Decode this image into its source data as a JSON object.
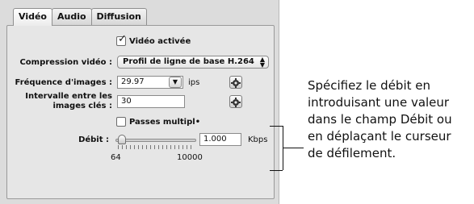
{
  "tabs": [
    {
      "label": "Vidéo",
      "active": true
    },
    {
      "label": "Audio",
      "active": false
    },
    {
      "label": "Diffusion",
      "active": false
    }
  ],
  "video_enabled": {
    "label": "Vidéo activée",
    "checked": true
  },
  "compression": {
    "label": "Compression vidéo :",
    "value": "Profil de ligne de base H.264"
  },
  "frame_rate": {
    "label": "Fréquence d'images :",
    "value": "29.97",
    "unit": "ips"
  },
  "keyframe": {
    "label_line1": "Intervalle entre les",
    "label_line2": "images clés :",
    "value": "30"
  },
  "multipass": {
    "label": "Passes multipl•",
    "checked": false
  },
  "bitrate": {
    "label": "Débit :",
    "value": "1.000",
    "unit": "Kbps",
    "min_label": "64",
    "max_label": "10000",
    "slider_fraction": 0.03
  },
  "callout": {
    "lines": [
      "Spécifiez le débit en",
      "introduisant une valeur",
      "dans le champ Débit ou",
      "en déplaçant le curseur",
      "de défilement."
    ]
  },
  "icons": {
    "checkmark": "checkmark-icon",
    "gear": "gear-icon",
    "popup_arrows": "up-down-arrows-icon",
    "combo_arrow": "chevron-down-icon"
  }
}
